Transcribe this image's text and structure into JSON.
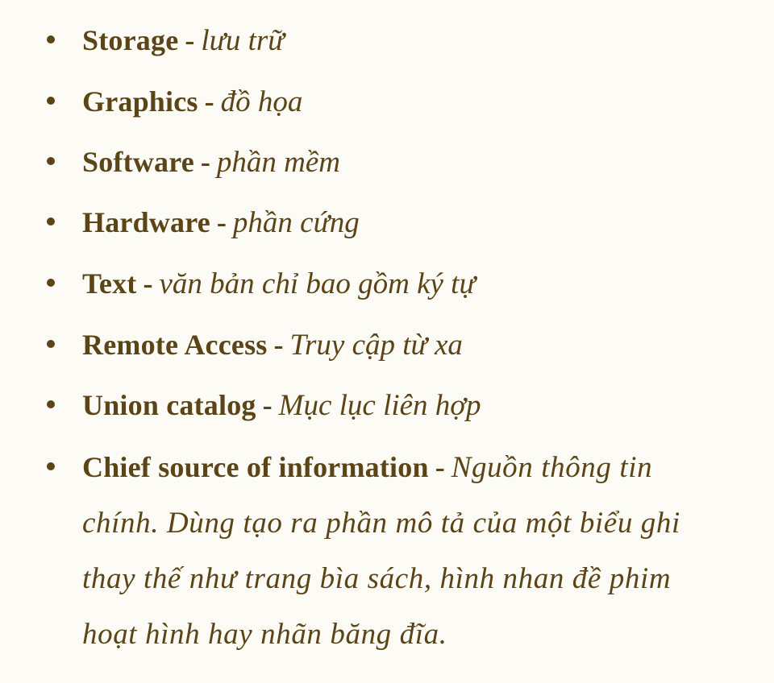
{
  "glossary": {
    "separator": "-",
    "items": [
      {
        "term": "Storage",
        "gloss": "lưu trữ"
      },
      {
        "term": "Graphics",
        "gloss": "đồ họa"
      },
      {
        "term": "Software",
        "gloss": "phần mềm"
      },
      {
        "term": "Hardware",
        "gloss": "phần cứng"
      },
      {
        "term": "Text",
        "gloss": "văn bản chỉ bao gồm ký tự"
      },
      {
        "term": "Remote Access",
        "gloss": "Truy cập từ xa"
      },
      {
        "term": "Union catalog",
        "gloss": "Mục lục liên hợp"
      },
      {
        "term": "Chief source of information",
        "gloss": "Nguồn thông tin chính. Dùng tạo ra phần mô tả của một biểu ghi thay thế như trang bìa sách, hình nhan đề phim hoạt hình hay nhãn băng đĩa."
      }
    ]
  }
}
